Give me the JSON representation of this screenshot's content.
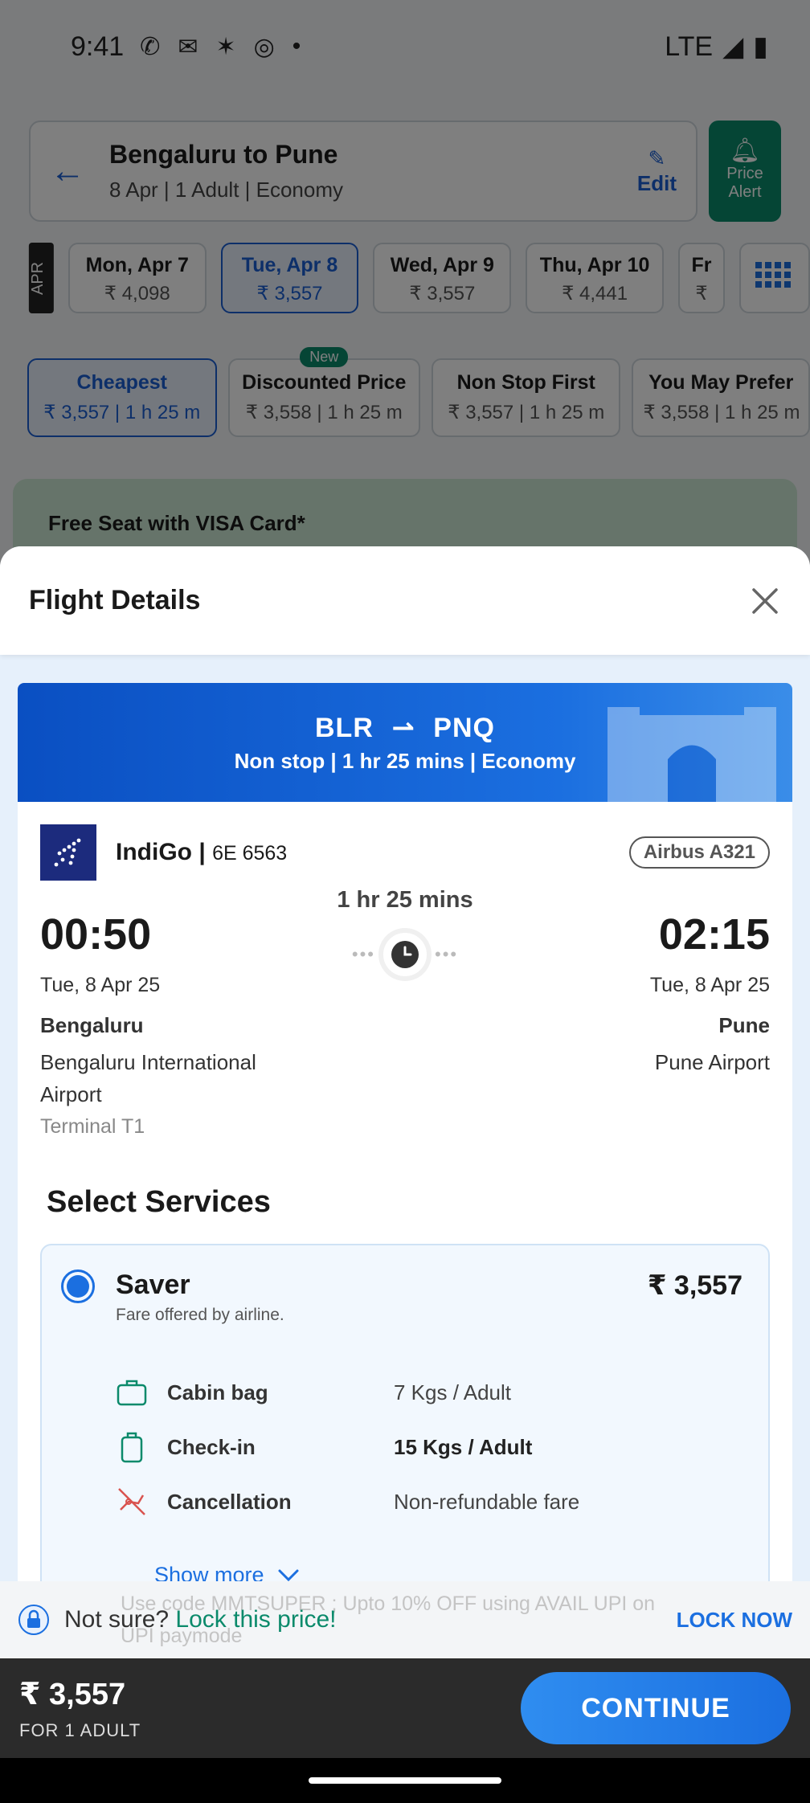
{
  "status_bar": {
    "time": "9:41",
    "network": "LTE"
  },
  "search": {
    "route": "Bengaluru to Pune",
    "details": "8 Apr | 1 Adult | Economy",
    "edit_label": "Edit",
    "price_alert_label": "Price Alert"
  },
  "dates": {
    "month_tag": "APR",
    "items": [
      {
        "day": "Mon, Apr 7",
        "price": "₹ 4,098"
      },
      {
        "day": "Tue, Apr 8",
        "price": "₹ 3,557"
      },
      {
        "day": "Wed, Apr 9",
        "price": "₹ 3,557"
      },
      {
        "day": "Thu, Apr 10",
        "price": "₹ 4,441"
      },
      {
        "day": "Fr",
        "price": "₹"
      }
    ]
  },
  "sort": {
    "new_badge": "New",
    "items": [
      {
        "title": "Cheapest",
        "sub": "₹ 3,557 | 1 h 25 m"
      },
      {
        "title": "Discounted Price",
        "sub": "₹ 3,558 | 1 h 25 m"
      },
      {
        "title": "Non Stop First",
        "sub": "₹ 3,557 | 1 h 25 m"
      },
      {
        "title": "You May Prefer",
        "sub": "₹ 3,558 | 1 h 25 m"
      }
    ]
  },
  "offer_banner": "Free Seat with VISA Card*",
  "sheet": {
    "title": "Flight Details"
  },
  "flight": {
    "from_code": "BLR",
    "to_code": "PNQ",
    "summary": "Non stop | 1 hr 25 mins | Economy",
    "airline": "IndiGo",
    "flight_number": "6E 6563",
    "aircraft": "Airbus A321",
    "duration": "1 hr 25 mins",
    "departure": {
      "time": "00:50",
      "date": "Tue, 8 Apr 25",
      "city": "Bengaluru",
      "airport": "Bengaluru International Airport",
      "terminal": "Terminal T1"
    },
    "arrival": {
      "time": "02:15",
      "date": "Tue, 8 Apr 25",
      "city": "Pune",
      "airport": "Pune Airport"
    }
  },
  "services": {
    "title": "Select Services",
    "fare": {
      "name": "Saver",
      "description": "Fare offered by airline.",
      "price": "₹ 3,557",
      "features": [
        {
          "icon": "cabin-bag-icon",
          "name": "Cabin bag",
          "value": "7 Kgs / Adult"
        },
        {
          "icon": "check-in-bag-icon",
          "name": "Check-in",
          "value": "15 Kgs / Adult"
        },
        {
          "icon": "cancellation-icon",
          "name": "Cancellation",
          "value": "Non-refundable fare"
        }
      ],
      "show_more": "Show more"
    }
  },
  "lock_price": {
    "prefix": "Not sure?",
    "link": "Lock this price!",
    "action": "LOCK NOW",
    "ghost_text": "Use code MMTSUPER ; Upto 10% OFF using AVAIL UPI on UPI paymode"
  },
  "bottom": {
    "total": "₹ 3,557",
    "sub": "FOR 1 ADULT",
    "continue_label": "CONTINUE"
  },
  "colors": {
    "accent": "#1b6fe0",
    "brand_green": "#0b8a6b",
    "banner": "#0a4fc2",
    "cancellation_red": "#d9534f"
  }
}
